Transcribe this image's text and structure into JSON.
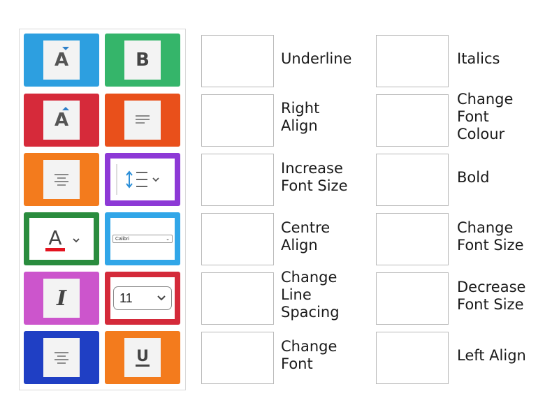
{
  "tiles": [
    {
      "name": "increase-font-size-tile",
      "color": "#2d9fe0",
      "icon": "increase-font-size-icon"
    },
    {
      "name": "bold-tile",
      "color": "#35b56a",
      "icon": "bold-icon",
      "text": "B"
    },
    {
      "name": "decrease-font-size-tile",
      "color": "#d62a3a",
      "icon": "decrease-font-size-icon"
    },
    {
      "name": "right-align-tile",
      "color": "#e9501b",
      "icon": "align-right-icon"
    },
    {
      "name": "centre-align-tile",
      "color": "#f37b1d",
      "icon": "align-center-icon"
    },
    {
      "name": "line-spacing-tile",
      "color": "#8d39d6",
      "icon": "line-spacing-icon"
    },
    {
      "name": "font-colour-tile",
      "color": "#2a8c3e",
      "icon": "font-colour-icon"
    },
    {
      "name": "font-name-tile",
      "color": "#31a6e8",
      "icon": "font-dropdown-icon",
      "text": "Calibri"
    },
    {
      "name": "italics-tile",
      "color": "#cc55cc",
      "icon": "italic-icon",
      "text": "I"
    },
    {
      "name": "font-size-tile",
      "color": "#d42a3a",
      "icon": "font-size-dropdown-icon",
      "text": "11"
    },
    {
      "name": "left-align-tile",
      "color": "#1f3fc4",
      "icon": "align-left-icon"
    },
    {
      "name": "underline-tile",
      "color": "#f37b1d",
      "icon": "underline-icon",
      "text": "U"
    }
  ],
  "targets": [
    {
      "label": "Underline"
    },
    {
      "label": "Italics"
    },
    {
      "label": "Right\nAlign"
    },
    {
      "label": "Change\nFont\nColour"
    },
    {
      "label": "Increase\nFont Size"
    },
    {
      "label": "Bold"
    },
    {
      "label": "Centre\nAlign"
    },
    {
      "label": "Change\nFont Size"
    },
    {
      "label": "Change\nLine\nSpacing"
    },
    {
      "label": "Decrease\nFont Size"
    },
    {
      "label": "Change\nFont"
    },
    {
      "label": "Left Align"
    }
  ]
}
